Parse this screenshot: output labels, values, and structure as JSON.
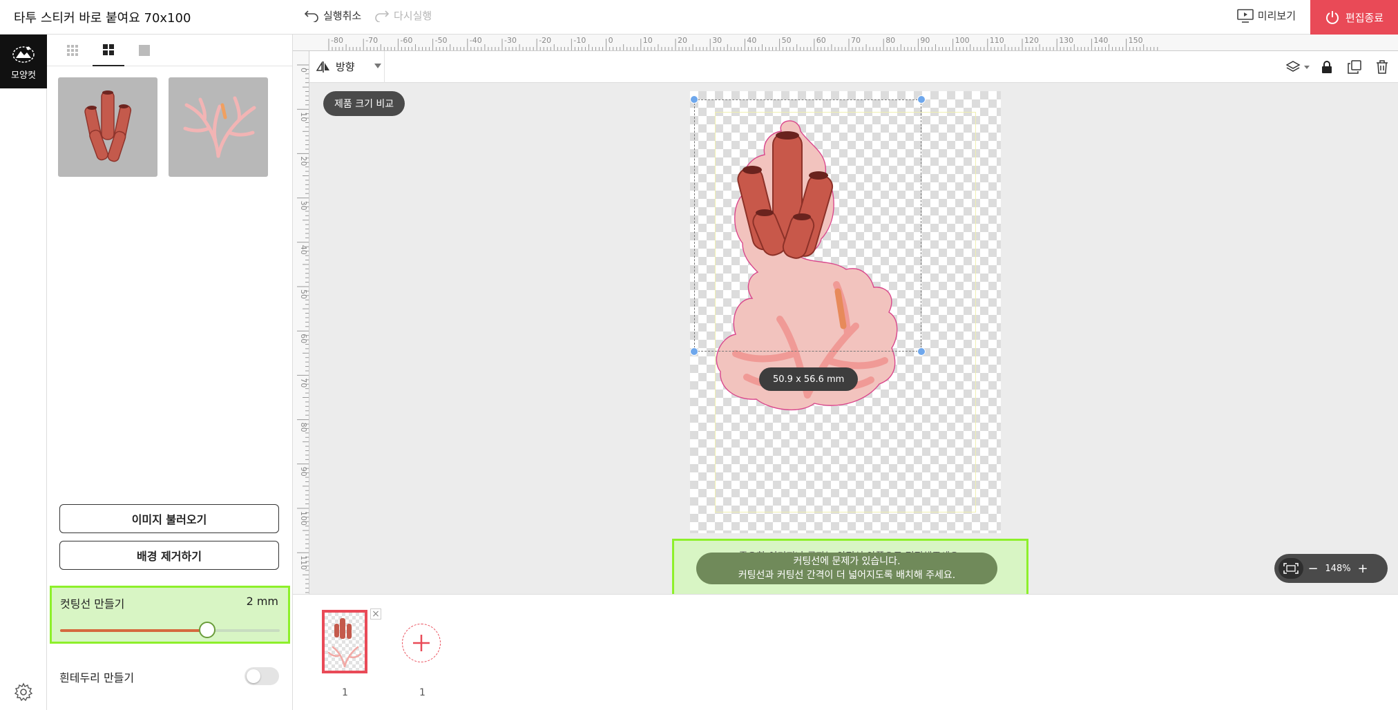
{
  "header": {
    "title": "타투 스티커 바로 붙여요 70x100",
    "undo_label": "실행취소",
    "redo_label": "다시실행",
    "preview_label": "미리보기",
    "exit_label": "편집종료"
  },
  "rail": {
    "tool_label": "모양컷"
  },
  "panel": {
    "import_image_label": "이미지 불러오기",
    "remove_bg_label": "배경 제거하기",
    "cutline": {
      "label": "컷팅선 만들기",
      "value": "2 mm",
      "level": 0.67
    },
    "white_border": {
      "label": "흰테두리 만들기",
      "enabled": false
    }
  },
  "ruler": {
    "top_labels": [
      "-80",
      "-70",
      "-60",
      "-50",
      "-40",
      "-30",
      "-20",
      "-10",
      "0",
      "10",
      "20",
      "30",
      "40",
      "50",
      "60",
      "70",
      "80",
      "90",
      "100",
      "110",
      "120",
      "130",
      "140",
      "150"
    ],
    "left_labels": [
      "0",
      "10",
      "20",
      "30",
      "40",
      "50",
      "60",
      "70",
      "80",
      "90",
      "100",
      "110"
    ]
  },
  "canvas_toolbar": {
    "direction_label": "방향"
  },
  "canvas": {
    "compare_label": "제품 크기 비교",
    "size_label": "50.9 x 56.6 mm",
    "safe_area_notice": "중요한 이미지나 글자는 안전선 안쪽으로 편집해주세요.",
    "warning_line1": "커팅선에 문제가 있습니다.",
    "warning_line2": "커팅선과 커팅선 간격이 더 넓어지도록 배치해 주세요.",
    "zoom": "148%"
  },
  "pages": {
    "page_number": "1",
    "page_count": "1"
  },
  "colors": {
    "accent": "#e94a57",
    "highlight": "#8df02a",
    "slider": "#d5693e"
  }
}
